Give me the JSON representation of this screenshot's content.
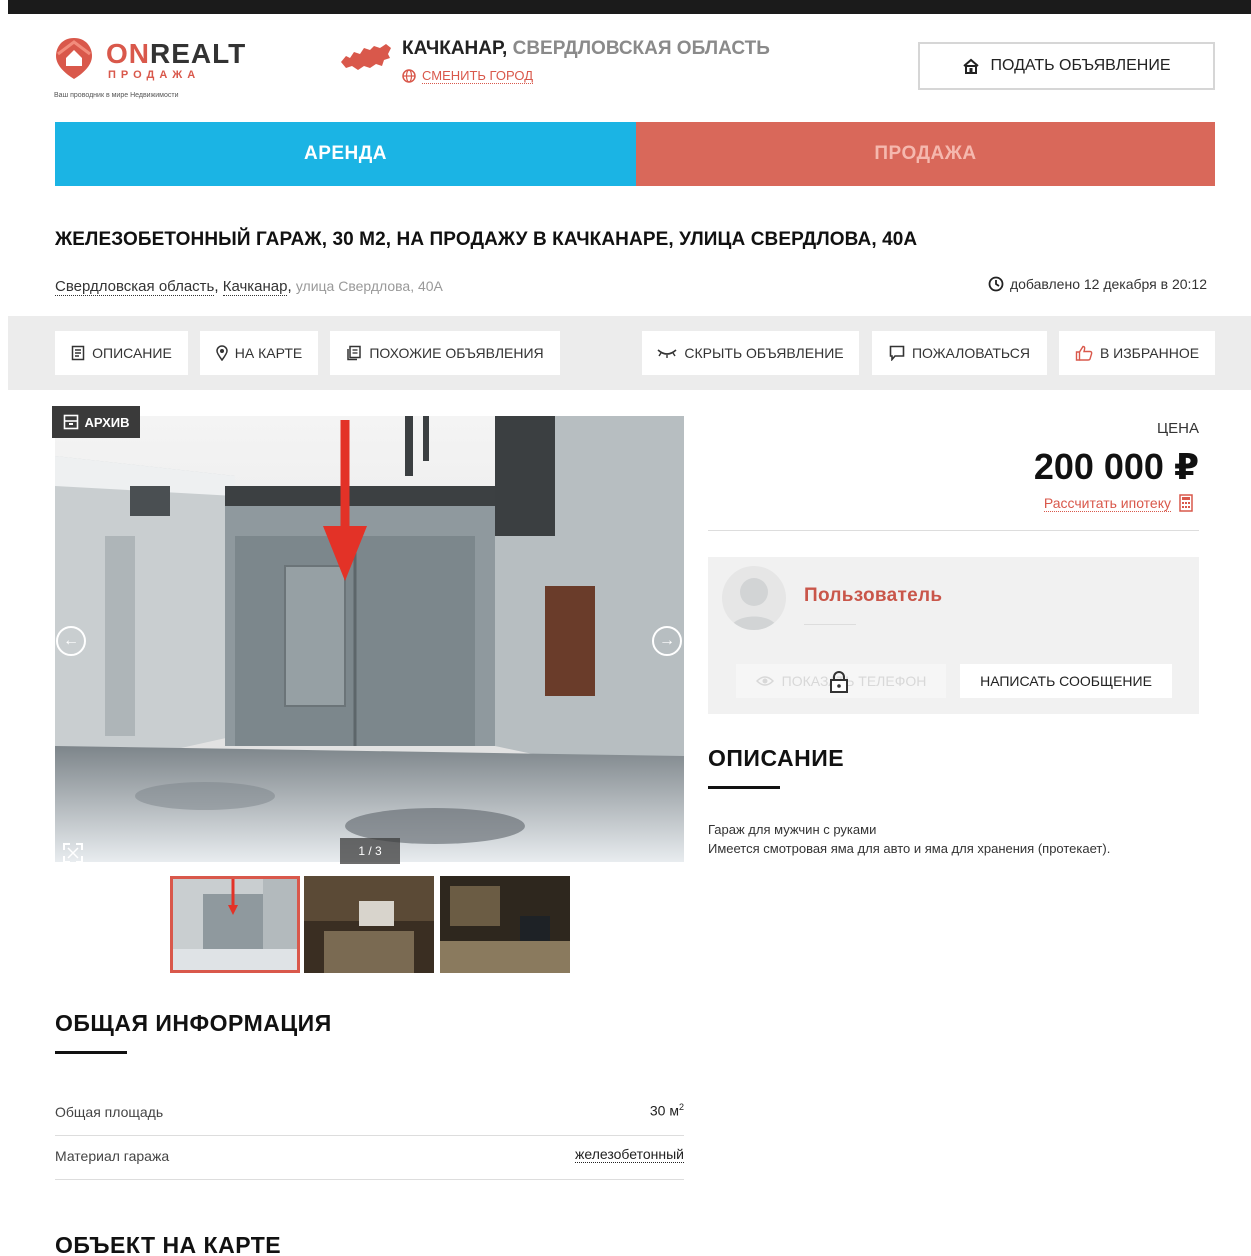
{
  "header": {
    "logo": {
      "brand_on": "ON",
      "brand_rest": "REALT",
      "sub": "ПРОДАЖА",
      "tagline": "Ваш проводник в мире Недвижимости"
    },
    "city": {
      "name": "КАЧКАНАР,",
      "region": "СВЕРДЛОВСКАЯ ОБЛАСТЬ",
      "change_label": "СМЕНИТЬ ГОРОД"
    },
    "post_button": "ПОДАТЬ ОБЪЯВЛЕНИЕ"
  },
  "tabs": [
    {
      "label": "АРЕНДА",
      "active": false
    },
    {
      "label": "ПРОДАЖА",
      "active": true
    }
  ],
  "listing": {
    "title": "ЖЕЛЕЗОБЕТОННЫЙ ГАРАЖ, 30 М2, НА ПРОДАЖУ В КАЧКАНАРЕ, УЛИЦА СВЕРДЛОВА, 40А",
    "region_link": "Свердловская область",
    "city_link": "Качканар",
    "street": "улица Свердлова, 40А",
    "added": "добавлено 12 декабря в 20:12"
  },
  "actions": {
    "description": "ОПИСАНИЕ",
    "on_map": "НА КАРТЕ",
    "similar": "ПОХОЖИЕ ОБЪЯВЛЕНИЯ",
    "hide": "СКРЫТЬ ОБЪЯВЛЕНИЕ",
    "complain": "ПОЖАЛОВАТЬСЯ",
    "favorite": "В ИЗБРАННОЕ"
  },
  "gallery": {
    "archive_label": "АРХИВ",
    "counter": "1 / 3"
  },
  "price": {
    "label": "ЦЕНА",
    "value": "200 000 ₽",
    "mortgage": "Рассчитать ипотеку"
  },
  "seller": {
    "name": "Пользователь",
    "show_phone": "ПОКАЗАТЬ ТЕЛЕФОН",
    "write_message": "НАПИСАТЬ СООБЩЕНИЕ"
  },
  "description": {
    "heading": "ОПИСАНИЕ",
    "line1": "Гараж для мужчин с руками",
    "line2": "Имеется смотровая яма для авто и яма для хранения (протекает)."
  },
  "general_info": {
    "heading": "ОБЩАЯ ИНФОРМАЦИЯ",
    "rows": [
      {
        "key": "Общая площадь",
        "value": "30 м",
        "sup": "2"
      },
      {
        "key": "Материал гаража",
        "value": "железобетонный"
      }
    ]
  },
  "map_section": {
    "heading": "ОБЪЕКТ НА КАРТЕ"
  },
  "colors": {
    "accent_red": "#d9584b",
    "rent_blue": "#1bb4e4",
    "sale_red": "#d9685a"
  }
}
